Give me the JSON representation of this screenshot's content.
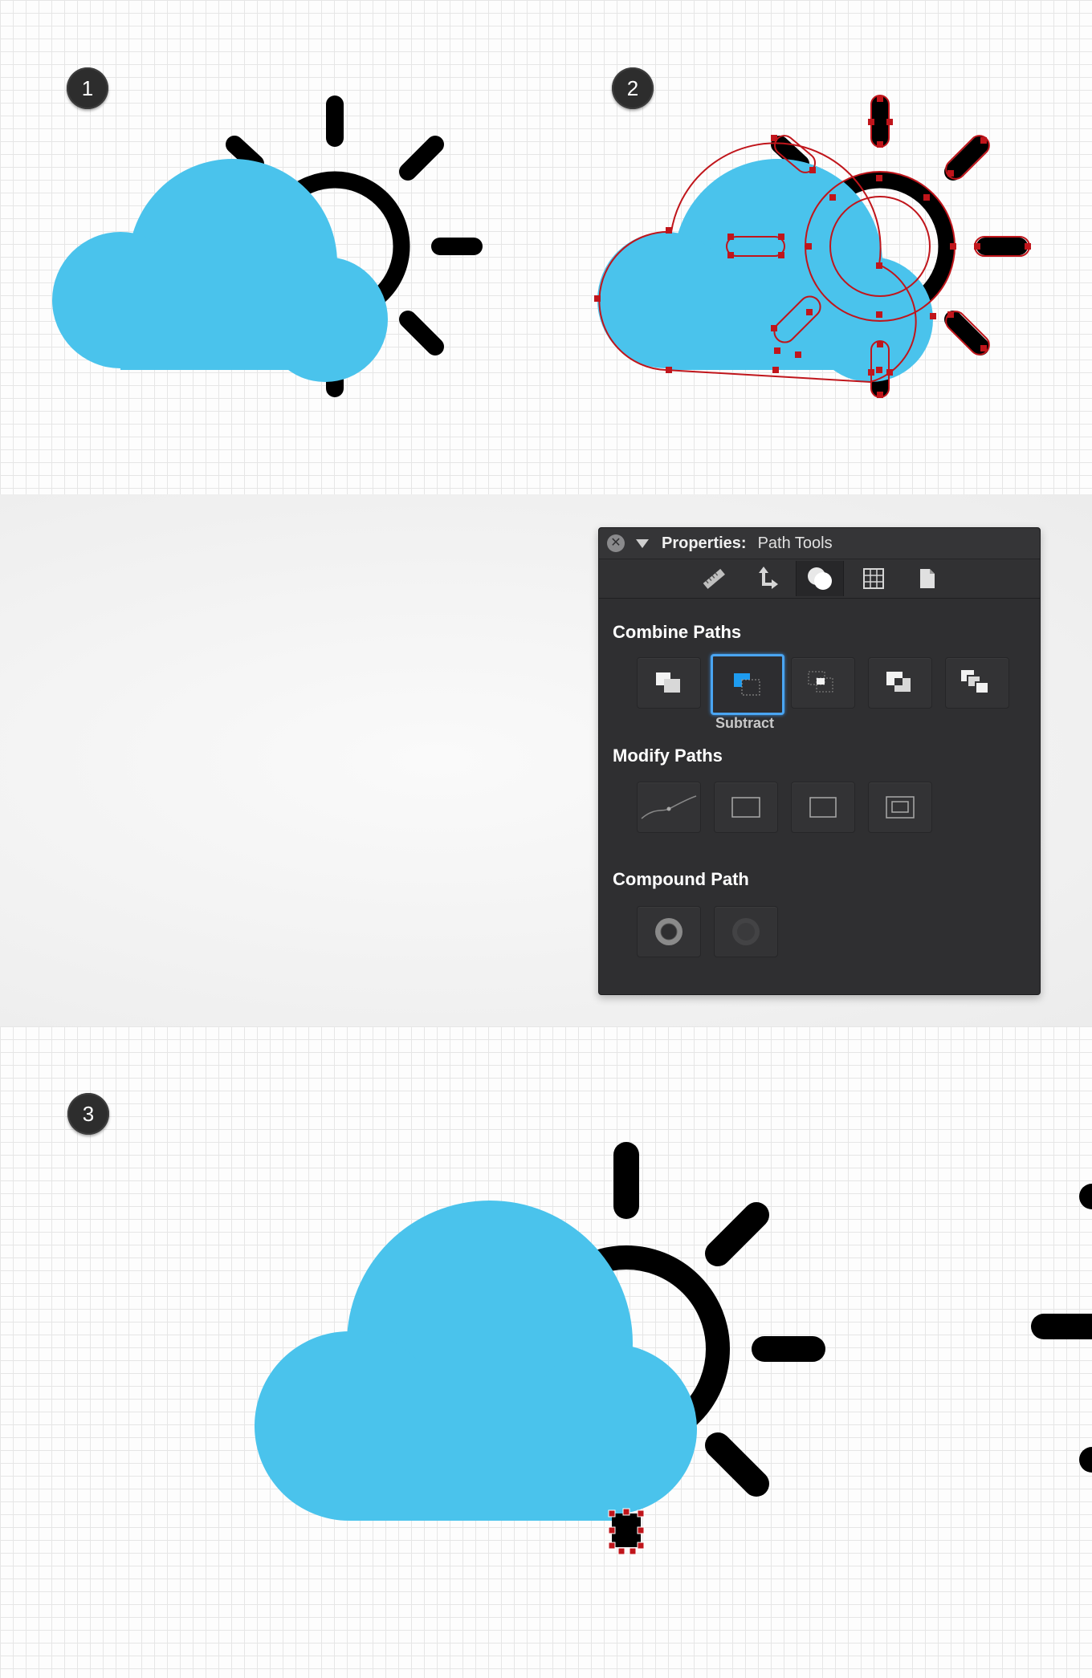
{
  "steps": {
    "one": "1",
    "two": "2",
    "three": "3"
  },
  "colors": {
    "cloud": "#4ac3ec",
    "sun": "#000000",
    "anchor": "#c0151b",
    "panel_bg": "#2f2f31",
    "selected_border": "#4aa5f2"
  },
  "panel": {
    "title_bold": "Properties:",
    "title_rest": "Path Tools",
    "close_icon": "close-icon",
    "collapse_icon": "triangle-down-icon",
    "tabs": [
      {
        "icon": "ruler-icon",
        "active": false
      },
      {
        "icon": "transform-arrows-icon",
        "active": false
      },
      {
        "icon": "path-combine-icon",
        "active": true
      },
      {
        "icon": "grid-table-icon",
        "active": false
      },
      {
        "icon": "document-icon",
        "active": false
      }
    ],
    "combine": {
      "title": "Combine Paths",
      "buttons": [
        {
          "icon": "add-shapes-icon",
          "selected": false
        },
        {
          "icon": "subtract-shapes-icon",
          "selected": true,
          "caption": "Subtract"
        },
        {
          "icon": "intersect-shapes-icon",
          "selected": false
        },
        {
          "icon": "exclude-shapes-icon",
          "selected": false
        },
        {
          "icon": "divide-shapes-icon",
          "selected": false
        }
      ]
    },
    "modify": {
      "title": "Modify Paths",
      "buttons": [
        {
          "icon": "smooth-path-icon"
        },
        {
          "icon": "rectangle-dashed-icon"
        },
        {
          "icon": "rectangle-icon"
        },
        {
          "icon": "inset-rectangle-icon"
        }
      ]
    },
    "compound": {
      "title": "Compound Path",
      "buttons": [
        {
          "icon": "make-compound-path-icon",
          "enabled": true
        },
        {
          "icon": "release-compound-path-icon",
          "enabled": false
        }
      ]
    }
  }
}
